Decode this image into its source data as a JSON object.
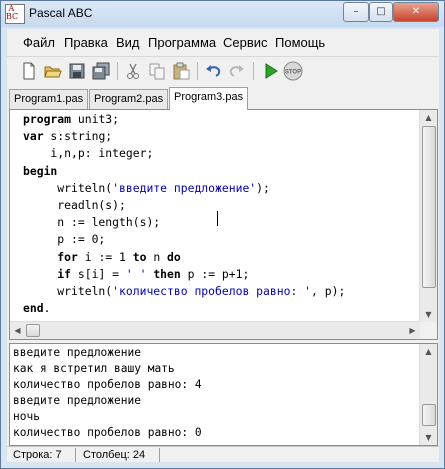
{
  "window": {
    "title": "Pascal ABC"
  },
  "title_buttons": {
    "minimize": "–",
    "maximize": "□",
    "close": "✕"
  },
  "menu": [
    "Файл",
    "Правка",
    "Вид",
    "Программа",
    "Сервис",
    "Помощь"
  ],
  "toolbar": [
    {
      "icon": "new-file-icon"
    },
    {
      "icon": "open-folder-icon"
    },
    {
      "icon": "save-icon"
    },
    {
      "icon": "save-all-icon"
    },
    {
      "icon": "cut-icon"
    },
    {
      "icon": "copy-icon"
    },
    {
      "icon": "paste-icon"
    },
    {
      "icon": "undo-icon"
    },
    {
      "icon": "redo-icon"
    },
    {
      "icon": "run-icon"
    },
    {
      "icon": "stop-icon",
      "label": "STOP"
    }
  ],
  "tabs": [
    {
      "label": "Program1.pas",
      "active": false
    },
    {
      "label": "Program2.pas",
      "active": false
    },
    {
      "label": "Program3.pas",
      "active": true
    }
  ],
  "editor": {
    "lines": [
      "program unit3;",
      "var s:string;",
      "    i,n,p: integer;",
      "begin",
      "     writeln('введите предложение');",
      "     readln(s);",
      "     n := length(s);",
      "     p := 0;",
      "     for i := 1 to n do",
      "     if s[i] = ' ' then p := p+1;",
      "     writeln('количество пробелов равно: ', p);",
      "end."
    ]
  },
  "output": {
    "lines": [
      "введите предложение",
      "как я встретил вашу мать",
      "количество пробелов равно: 4",
      "введите предложение",
      "ночь",
      "количество пробелов равно: 0"
    ]
  },
  "status": {
    "row": "Строка: 7",
    "col": "Столбец: 24"
  },
  "colors": {
    "string": "#0000c0",
    "title_bg": "#c7daef",
    "run": "#2aa52a",
    "stop": "#cc2222"
  }
}
